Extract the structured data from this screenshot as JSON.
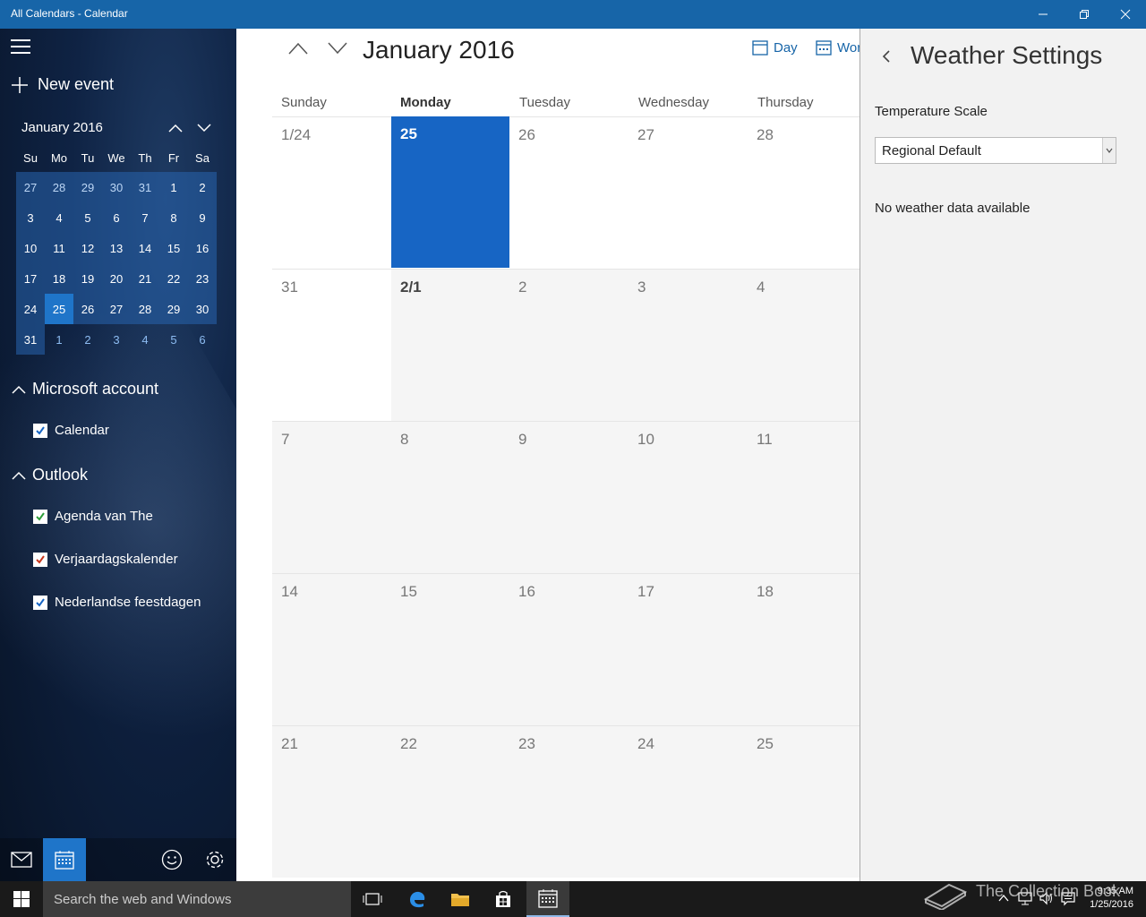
{
  "window": {
    "title": "All Calendars - Calendar"
  },
  "sidebar": {
    "new_event": "New event",
    "mini_month": "January 2016",
    "mini_days": [
      "Su",
      "Mo",
      "Tu",
      "We",
      "Th",
      "Fr",
      "Sa"
    ],
    "groups": [
      {
        "name": "Microsoft account",
        "calendars": [
          {
            "label": "Calendar",
            "color": "#1765c4"
          }
        ]
      },
      {
        "name": "Outlook",
        "calendars": [
          {
            "label": "Agenda van The",
            "color": "#2e9e3a"
          },
          {
            "label": "Verjaardagskalender",
            "color": "#c8361c"
          },
          {
            "label": "Nederlandse feestdagen",
            "color": "#1765c4"
          }
        ]
      }
    ]
  },
  "main": {
    "title": "January 2016",
    "views": {
      "day": "Day",
      "workweek": "Wor"
    },
    "days": [
      "Sunday",
      "Monday",
      "Tuesday",
      "Wednesday",
      "Thursday"
    ],
    "weeks": [
      [
        "1/24",
        "25",
        "26",
        "27",
        "28"
      ],
      [
        "31",
        "2/1",
        "2",
        "3",
        "4"
      ],
      [
        "7",
        "8",
        "9",
        "10",
        "11"
      ],
      [
        "14",
        "15",
        "16",
        "17",
        "18"
      ],
      [
        "21",
        "22",
        "23",
        "24",
        "25"
      ]
    ]
  },
  "weather": {
    "title": "Weather Settings",
    "scale_label": "Temperature Scale",
    "scale_value": "Regional Default",
    "no_data": "No weather data available"
  },
  "taskbar": {
    "search_placeholder": "Search the web and Windows",
    "time": "9:35 AM",
    "date": "1/25/2016",
    "watermark": "The Collection Book"
  },
  "colors": {
    "accent": "#1765c4",
    "titlebar": "#1765a8"
  }
}
